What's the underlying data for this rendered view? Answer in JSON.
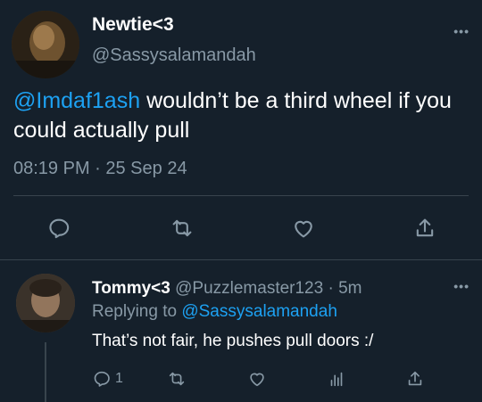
{
  "main_tweet": {
    "display_name": "Newtie<3",
    "handle": "@Sassysalamandah",
    "mention": "@Imdaf1ash",
    "text": " wouldn’t be a third wheel if you could actually pull",
    "timestamp": "08:19 PM · 25 Sep 24",
    "more_label": "•••",
    "actions": {
      "reply_icon": "reply-icon",
      "retweet_icon": "retweet-icon",
      "like_icon": "heart-icon",
      "share_icon": "share-icon"
    }
  },
  "reply_tweet": {
    "display_name": "Tommy<3",
    "handle": " @Puzzlemaster123 · 5m",
    "replying_prefix": "Replying to ",
    "replying_to": "@Sassysalamandah",
    "text": "That’s not fair, he pushes pull doors :/",
    "more_label": "•••",
    "reply_count": "1",
    "actions": {
      "reply_icon": "reply-icon",
      "retweet_icon": "retweet-icon",
      "like_icon": "heart-icon",
      "analytics_icon": "analytics-icon",
      "share_icon": "share-icon"
    }
  },
  "colors": {
    "background": "#15202b",
    "primary_text": "#ffffff",
    "secondary_text": "#8899a6",
    "accent": "#1da1f2",
    "divider": "#38444d"
  }
}
